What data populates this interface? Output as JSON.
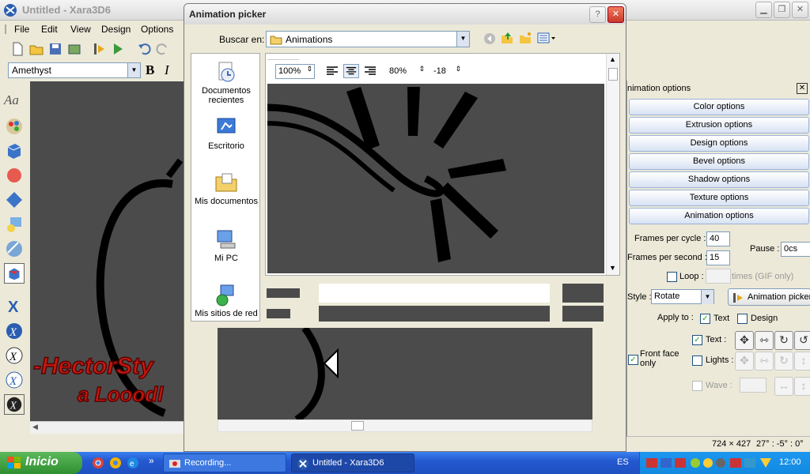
{
  "window": {
    "title": "Untitled - Xara3D6"
  },
  "menu": [
    "File",
    "Edit",
    "View",
    "Design",
    "Options"
  ],
  "fontbar": {
    "font": "Amethyst",
    "bold": "B",
    "italic": "I"
  },
  "dialog": {
    "title": "Animation picker",
    "help": "?",
    "close": "✕",
    "look_in_label": "Buscar en:",
    "look_in_value": "Animations",
    "places": [
      "Documentos recientes",
      "Escritorio",
      "Mis documentos",
      "Mi PC",
      "Mis sitios de red"
    ],
    "preview_toolbar": {
      "zoom": "100%",
      "scale": "80%",
      "angle": "-18"
    }
  },
  "right_panel": {
    "header": "nimation options",
    "buttons": [
      "Color options",
      "Extrusion options",
      "Design options",
      "Bevel options",
      "Shadow options",
      "Texture options",
      "Animation options"
    ],
    "frames_per_cycle_label": "Frames per cycle :",
    "frames_per_cycle": "40",
    "frames_per_second_label": "Frames per second :",
    "frames_per_second": "15",
    "pause_label": "Pause :",
    "pause_value": "0cs",
    "loop_label": "Loop :",
    "times_label": "times (GIF only)",
    "style_label": "Style :",
    "style_value": "Rotate",
    "animation_picker_button": "Animation picker",
    "apply_to_label": "Apply to :",
    "apply_text": "Text",
    "apply_design": "Design",
    "text_label": "Text :",
    "front_face_label": "Front face only",
    "lights_label": "Lights :",
    "wave_label": "Wave :"
  },
  "statusbar": {
    "size": "724 × 427",
    "angles": "27° : -5° : 0°"
  },
  "taskbar": {
    "start": "Inicio",
    "tasks": [
      "Recording...",
      "Untitled - Xara3D6"
    ],
    "lang": "ES",
    "clock": "12:00"
  }
}
